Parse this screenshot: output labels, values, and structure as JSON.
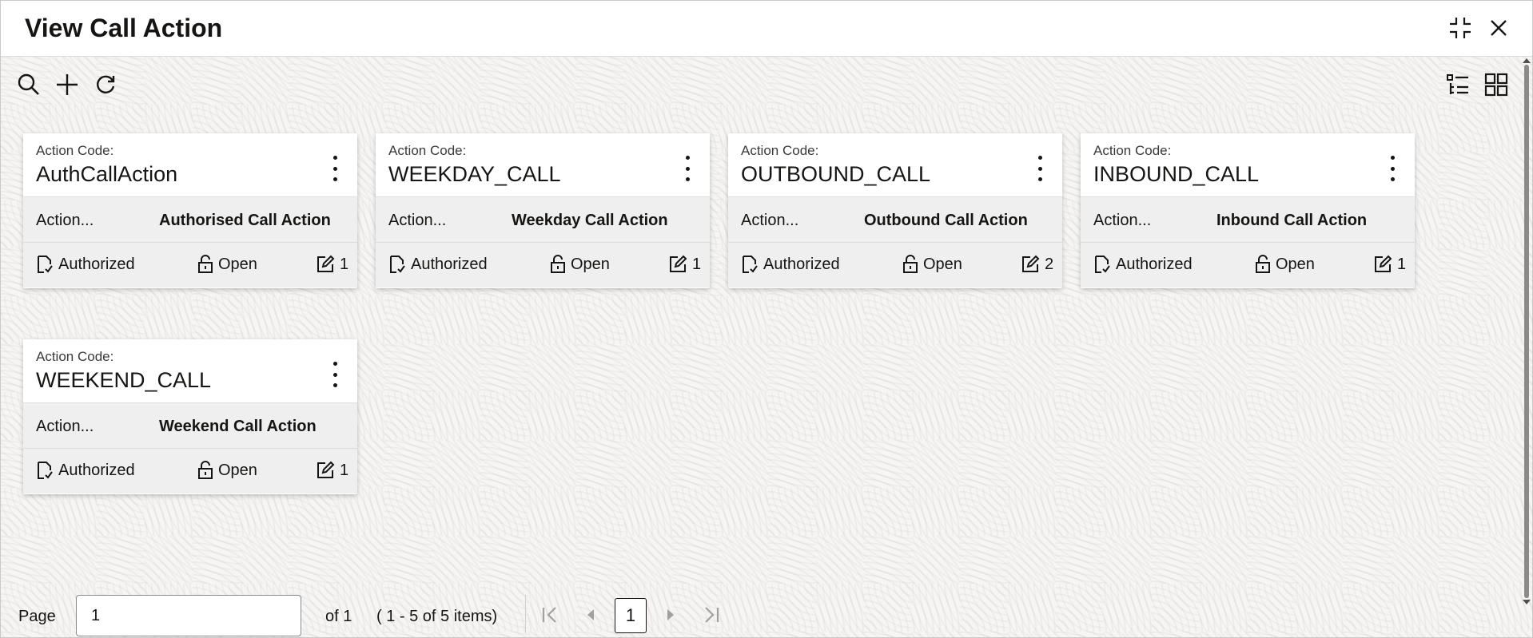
{
  "window": {
    "title": "View Call Action"
  },
  "colors": {
    "accent": "#161513",
    "card_bg": "#ffffff",
    "row_bg": "#efefef"
  },
  "icons": {
    "minimize": "compress-icon",
    "close": "close-icon",
    "search": "search-icon",
    "add": "plus-icon",
    "refresh": "refresh-icon",
    "list_view": "list-view-icon",
    "grid_view": "grid-view-icon",
    "kebab": "kebab-menu-icon",
    "authorized": "document-check-icon",
    "open": "unlock-icon",
    "edit": "edit-icon"
  },
  "cards": [
    {
      "label": "Action Code:",
      "code": "AuthCallAction",
      "field_label": "Action...",
      "field_value": "Authorised Call Action",
      "auth": "Authorized",
      "status": "Open",
      "mods": "1"
    },
    {
      "label": "Action Code:",
      "code": "WEEKDAY_CALL",
      "field_label": "Action...",
      "field_value": "Weekday Call Action",
      "auth": "Authorized",
      "status": "Open",
      "mods": "1"
    },
    {
      "label": "Action Code:",
      "code": "OUTBOUND_CALL",
      "field_label": "Action...",
      "field_value": "Outbound Call Action",
      "auth": "Authorized",
      "status": "Open",
      "mods": "2"
    },
    {
      "label": "Action Code:",
      "code": "INBOUND_CALL",
      "field_label": "Action...",
      "field_value": "Inbound Call Action",
      "auth": "Authorized",
      "status": "Open",
      "mods": "1"
    },
    {
      "label": "Action Code:",
      "code": "WEEKEND_CALL",
      "field_label": "Action...",
      "field_value": "Weekend Call Action",
      "auth": "Authorized",
      "status": "Open",
      "mods": "1"
    }
  ],
  "pager": {
    "page_label": "Page",
    "page_value": "1",
    "of_text": "of 1",
    "range_text": "( 1 - 5 of 5 items)",
    "current_page": "1"
  }
}
